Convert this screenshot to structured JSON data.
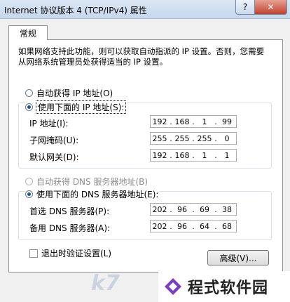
{
  "window": {
    "title": "Internet 协议版本 4 (TCP/IPv4) 属性",
    "help": "?",
    "close": "✕"
  },
  "tabs": [
    "常规"
  ],
  "description": "如果网络支持此功能，则可以获取自动指派的 IP 设置。否则，您需要从网络系统管理员处获得适当的 IP 设置。",
  "ip": {
    "auto_label": "自动获得 IP 地址(O)",
    "manual_label": "使用下面的 IP 地址(S):",
    "mode": "manual",
    "fields": [
      {
        "label": "IP 地址(I):",
        "octets": [
          "192",
          "168",
          "1",
          "99"
        ]
      },
      {
        "label": "子网掩码(U):",
        "octets": [
          "255",
          "255",
          "255",
          "0"
        ]
      },
      {
        "label": "默认网关(D):",
        "octets": [
          "192",
          "168",
          "1",
          "1"
        ]
      }
    ]
  },
  "dns": {
    "auto_label": "自动获得 DNS 服务器地址(B)",
    "manual_label": "使用下面的 DNS 服务器地址(E):",
    "fields": [
      {
        "label": "首选 DNS 服务器(P):",
        "octets": [
          "202",
          "96",
          "69",
          "38"
        ]
      },
      {
        "label": "备用 DNS 服务器(A):",
        "octets": [
          "202",
          "96",
          "64",
          "68"
        ]
      }
    ]
  },
  "validate_label": "退出时验证设置(L)",
  "advanced_label": "高级(V)...",
  "watermark": {
    "left": "k7",
    "right": "程式软件园"
  }
}
